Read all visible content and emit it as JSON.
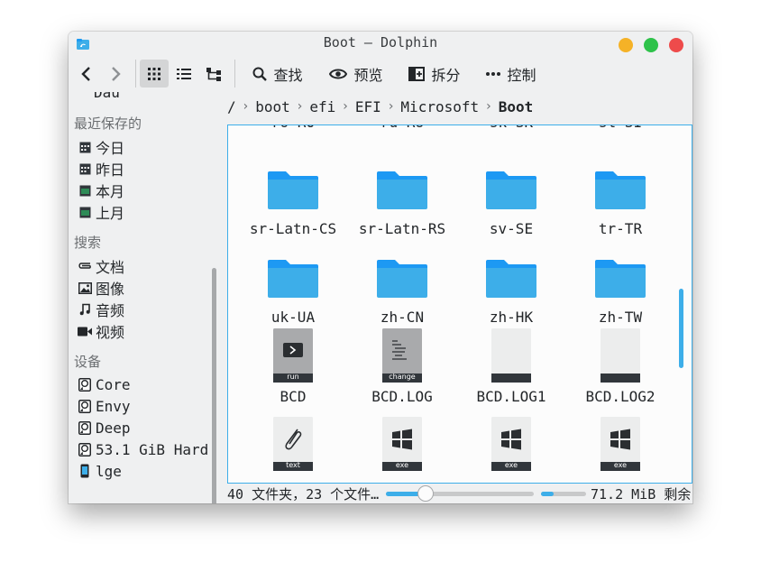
{
  "window": {
    "title": "Boot — Dolphin"
  },
  "toolbar": {
    "search_label": "查找",
    "preview_label": "预览",
    "split_label": "拆分",
    "control_label": "控制"
  },
  "sidebar": {
    "partial_item": "Dau",
    "recent_heading": "最近保存的",
    "recent_items": [
      {
        "label": "今日",
        "icon": "calendar-icon"
      },
      {
        "label": "昨日",
        "icon": "calendar-icon"
      },
      {
        "label": "本月",
        "icon": "calendar-icon"
      },
      {
        "label": "上月",
        "icon": "calendar-icon"
      }
    ],
    "search_heading": "搜索",
    "search_items": [
      {
        "label": "文档",
        "icon": "paperclip-icon"
      },
      {
        "label": "图像",
        "icon": "image-icon"
      },
      {
        "label": "音频",
        "icon": "music-note-icon"
      },
      {
        "label": "视频",
        "icon": "video-icon"
      }
    ],
    "devices_heading": "设备",
    "device_items": [
      {
        "label": "Core",
        "icon": "hard-drive-icon"
      },
      {
        "label": "Envy",
        "icon": "hard-drive-icon"
      },
      {
        "label": "Deep",
        "icon": "hard-drive-icon"
      },
      {
        "label": "53.1 GiB Hard",
        "icon": "hard-drive-icon"
      },
      {
        "label": "lge",
        "icon": "phone-icon"
      }
    ]
  },
  "breadcrumb": {
    "root": "/",
    "items": [
      "boot",
      "efi",
      "EFI",
      "Microsoft"
    ],
    "current": "Boot"
  },
  "files": [
    {
      "name": "ro-RO",
      "type": "folder"
    },
    {
      "name": "ru-RU",
      "type": "folder"
    },
    {
      "name": "sk-SK",
      "type": "folder"
    },
    {
      "name": "sl-SI",
      "type": "folder"
    },
    {
      "name": "sr-Latn-CS",
      "type": "folder"
    },
    {
      "name": "sr-Latn-RS",
      "type": "folder"
    },
    {
      "name": "sv-SE",
      "type": "folder"
    },
    {
      "name": "tr-TR",
      "type": "folder"
    },
    {
      "name": "uk-UA",
      "type": "folder"
    },
    {
      "name": "zh-CN",
      "type": "folder"
    },
    {
      "name": "zh-HK",
      "type": "folder"
    },
    {
      "name": "zh-TW",
      "type": "folder"
    },
    {
      "name": "BCD",
      "type": "run",
      "badge": "run"
    },
    {
      "name": "BCD.LOG",
      "type": "change",
      "badge": "change"
    },
    {
      "name": "BCD.LOG1",
      "type": "blank",
      "badge": ""
    },
    {
      "name": "BCD.LOG2",
      "type": "blank",
      "badge": ""
    },
    {
      "name": "",
      "type": "text",
      "badge": "text"
    },
    {
      "name": "",
      "type": "exe",
      "badge": "exe"
    },
    {
      "name": "",
      "type": "exe",
      "badge": "exe"
    },
    {
      "name": "",
      "type": "exe",
      "badge": "exe"
    }
  ],
  "status": {
    "summary": "40 文件夹，23 个文件…",
    "free_space": "71.2 MiB 剩余",
    "zoom_level": 0.27,
    "space_used": 0.28
  },
  "colors": {
    "accent": "#3daee9",
    "folder": "#3daee9",
    "folder_tab": "#1d99f3"
  }
}
